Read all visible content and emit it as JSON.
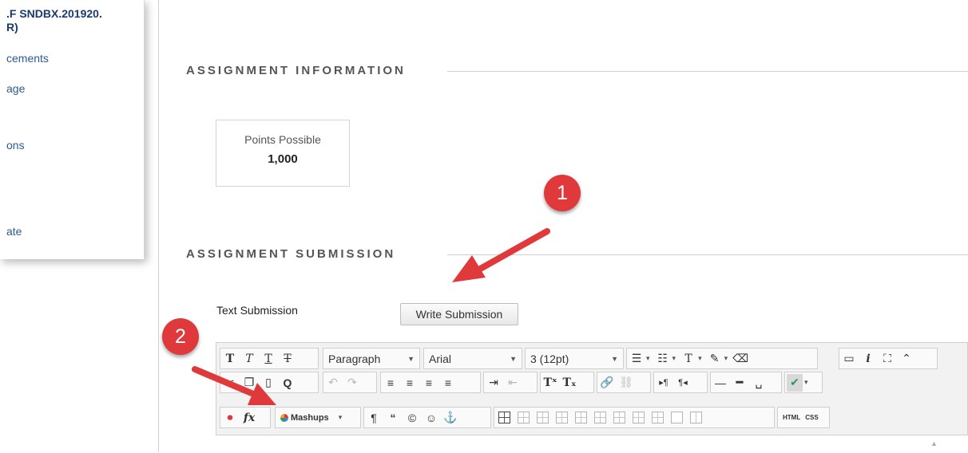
{
  "sidebar": {
    "course_line1": ".F SNDBX.201920.",
    "course_line2": "R)",
    "items": [
      {
        "label": "cements"
      },
      {
        "label": "age"
      },
      {
        "label": "ons"
      },
      {
        "label": "ate"
      }
    ]
  },
  "assignment_information": {
    "title": "ASSIGNMENT INFORMATION",
    "points_label": "Points Possible",
    "points_value": "1,000"
  },
  "assignment_submission": {
    "title": "ASSIGNMENT SUBMISSION",
    "text_submission_label": "Text Submission",
    "write_button": "Write Submission"
  },
  "editor": {
    "format_select": "Paragraph",
    "font_select": "Arial",
    "size_select": "3 (12pt)",
    "mashups_label": "Mashups",
    "html_label": "HTML",
    "css_label": "CSS"
  },
  "annotations": {
    "step1": "1",
    "step2": "2",
    "color": "#e0393b"
  },
  "colors": {
    "link": "#2a5a97",
    "heading": "#555555"
  }
}
